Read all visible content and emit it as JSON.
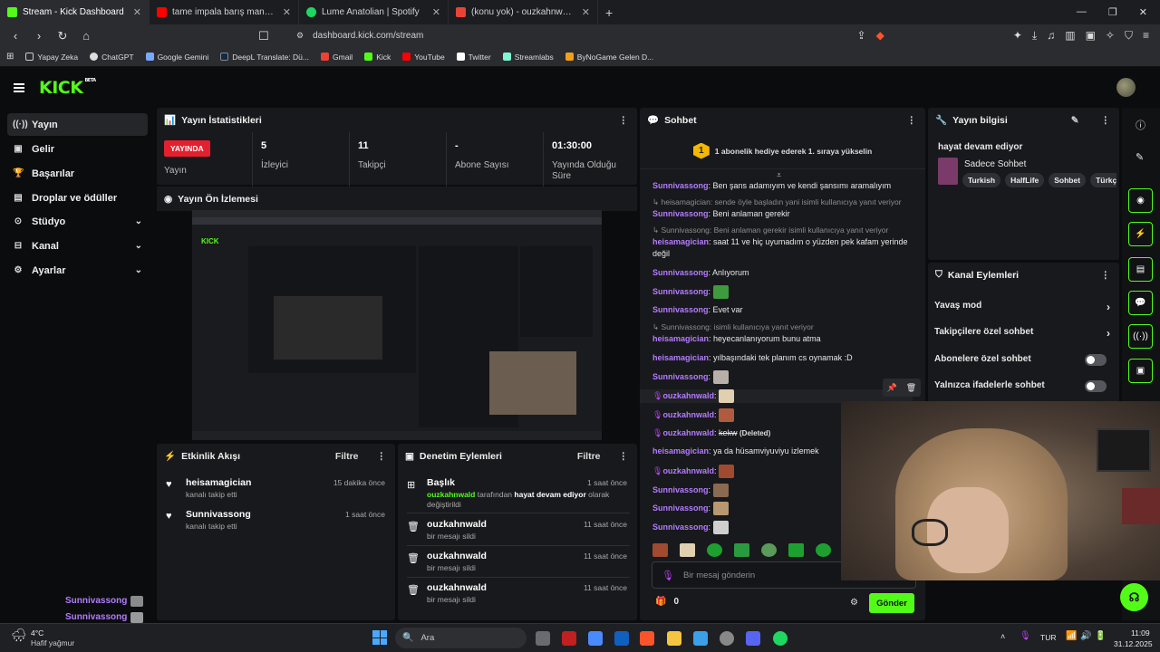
{
  "browser": {
    "tabs": [
      {
        "title": "Stream - Kick Dashboard",
        "color": "#53fc18",
        "active": true
      },
      {
        "title": "tame impala barış manço - YouTube",
        "color": "#ff0000",
        "active": false
      },
      {
        "title": "Lume Anatolian | Spotify",
        "color": "#1ed760",
        "active": false
      },
      {
        "title": "(konu yok) - ouzkahnwald@gmail.co",
        "color": "#ea4335",
        "active": false
      }
    ],
    "url": "dashboard.kick.com/stream",
    "bookmarks": [
      "Yapay Zeka",
      "ChatGPT",
      "Google Gemini",
      "DeepL Translate: Dü...",
      "Gmail",
      "Kick",
      "YouTube",
      "Twitter",
      "Streamlabs",
      "ByNoGame Gelen D..."
    ]
  },
  "logo": {
    "text": "KICK",
    "beta": "BETA"
  },
  "sidebar": {
    "items": [
      {
        "label": "Yayın",
        "icon": "broadcast-icon"
      },
      {
        "label": "Gelir",
        "icon": "wallet-icon"
      },
      {
        "label": "Başarılar",
        "icon": "trophy-icon"
      },
      {
        "label": "Droplar ve ödüller",
        "icon": "gift-icon"
      },
      {
        "label": "Stüdyo",
        "icon": "studio-icon"
      },
      {
        "label": "Kanal",
        "icon": "channel-icon"
      },
      {
        "label": "Ayarlar",
        "icon": "gear-icon"
      }
    ],
    "bottom_names": [
      "Sunnivassong",
      "Sunnivassong"
    ]
  },
  "stats": {
    "title": "Yayın İstatistikleri",
    "live_badge": "YAYINDA",
    "live_label": "Yayın",
    "items": [
      {
        "value": "5",
        "label": "İzleyici"
      },
      {
        "value": "11",
        "label": "Takipçi"
      },
      {
        "value": "-",
        "label": "Abone Sayısı"
      },
      {
        "value": "01:30:00",
        "label": "Yayında Olduğu Süre"
      }
    ]
  },
  "preview": {
    "title": "Yayın Ön İzlemesi"
  },
  "activity": {
    "title": "Etkinlik Akışı",
    "filter": "Filtre",
    "items": [
      {
        "name": "heisamagician",
        "sub": "kanalı takip etti",
        "time": "15 dakika önce"
      },
      {
        "name": "Sunnivassong",
        "sub": "kanalı takip etti",
        "time": "1 saat önce"
      }
    ]
  },
  "moderation": {
    "title": "Denetim Eylemleri",
    "filter": "Filtre",
    "first": {
      "title": "Başlık",
      "user": "ouzkahnwald",
      "mid": "tarafından",
      "value": "hayat devam ediyor",
      "tail": "olarak değiştirildi",
      "time": "1 saat önce"
    },
    "items": [
      {
        "name": "ouzkahnwald",
        "sub": "bir mesajı sildi",
        "time": "11 saat önce"
      },
      {
        "name": "ouzkahnwald",
        "sub": "bir mesajı sildi",
        "time": "11 saat önce"
      },
      {
        "name": "ouzkahnwald",
        "sub": "bir mesajı sildi",
        "time": "11 saat önce"
      }
    ]
  },
  "chat": {
    "title": "Sohbet",
    "gift_badge": "1",
    "gift_text": "1 abonelik hediye ederek 1. sıraya yükselin",
    "placeholder": "Bir mesaj gönderin",
    "points": "0",
    "send": "Gönder",
    "deleted_tag": "(Deleted)",
    "messages": [
      {
        "user": "Sunnivassong",
        "text": "Ben şans adamıyım ve kendi şansımı aramalıyım"
      },
      {
        "reply": "heisamagician: sende öyle başladın yani isimli kullanıcıya yanıt veriyor",
        "user": "Sunnivassong",
        "text": "Beni anlaman gerekir"
      },
      {
        "reply": "Sunnivassong: Beni anlaman gerekir isimli kullanıcıya yanıt veriyor",
        "user": "heisamagician",
        "text": "saat 11 ve hiç uyumadım o yüzden pek kafam yerinde değil"
      },
      {
        "user": "Sunnivassong",
        "text": "Anlıyorum"
      },
      {
        "user": "Sunnivassong",
        "text": ""
      },
      {
        "user": "Sunnivassong",
        "text": "Evet var"
      },
      {
        "reply": "Sunnivassong: isimli kullanıcıya yanıt veriyor",
        "user": "heisamagician",
        "text": "heyecanlanıyorum bunu atma"
      },
      {
        "user": "heisamagician",
        "text": "yılbaşındaki tek planım cs oynamak :D"
      },
      {
        "user": "Sunnivassong",
        "text": ""
      },
      {
        "user": "ouzkahnwald",
        "text": ""
      },
      {
        "user": "ouzkahnwald",
        "text": ""
      },
      {
        "user": "ouzkahnwald",
        "text": "kekw"
      },
      {
        "user": "heisamagician",
        "text": "ya da hüsamviyuviyu izlemek"
      },
      {
        "user": "ouzkahnwald",
        "text": ""
      },
      {
        "user": "Sunnivassong",
        "text": ""
      },
      {
        "user": "Sunnivassong",
        "text": ""
      },
      {
        "user": "Sunnivassong",
        "text": ""
      }
    ]
  },
  "streaminfo": {
    "title": "Yayın bilgisi",
    "stream_title": "hayat devam ediyor",
    "category": "Sadece Sohbet",
    "tags": [
      "Turkish",
      "HalfLife",
      "Sohbet",
      "Türkç"
    ]
  },
  "channel_actions": {
    "title": "Kanal Eylemleri",
    "items": [
      "Yavaş mod",
      "Takipçilere özel sohbet",
      "Abonelere özel sohbet",
      "Yalnızca ifadelerle sohbet"
    ]
  },
  "taskbar": {
    "weather_temp": "4°C",
    "weather_desc": "Hafif yağmur",
    "search": "Ara",
    "lang": "TUR",
    "time": "11:09",
    "date": "31.12.2025"
  }
}
